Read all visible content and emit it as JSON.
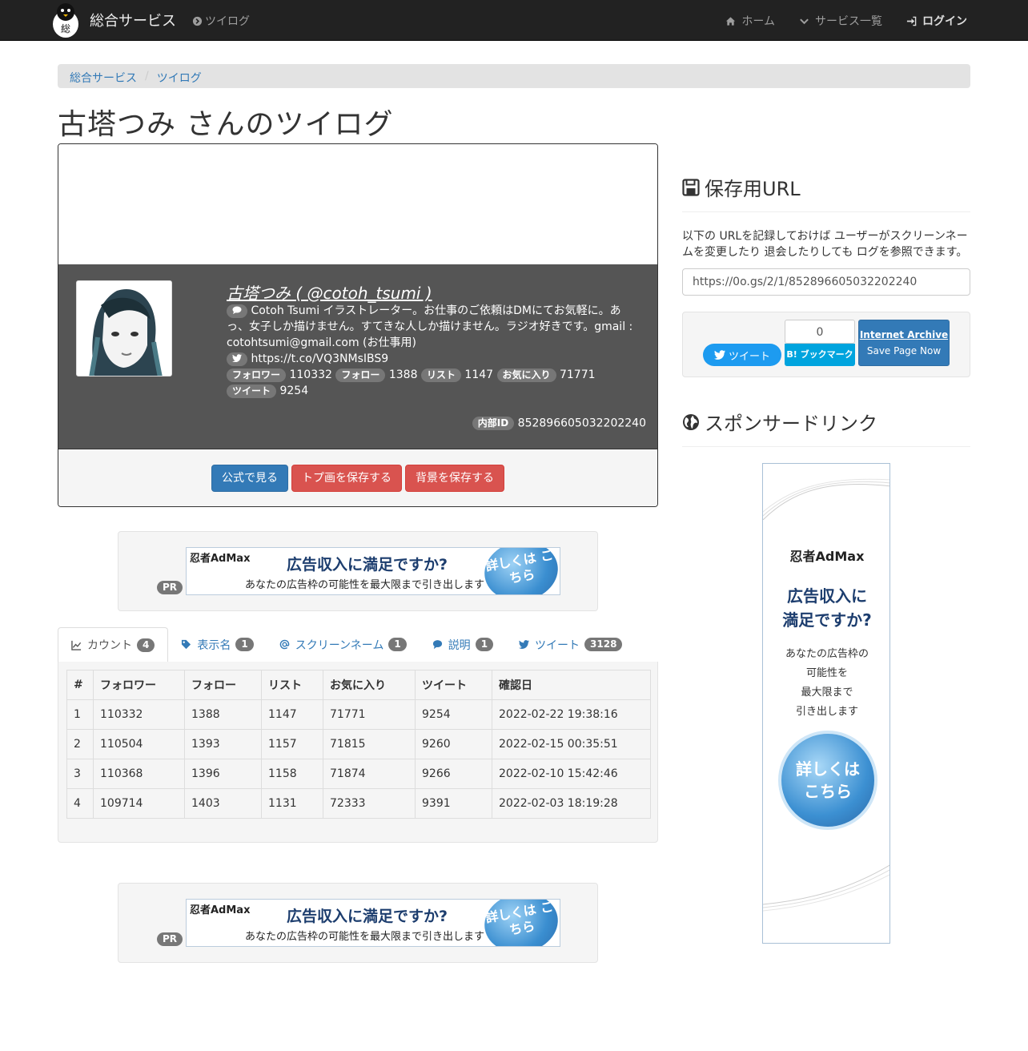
{
  "navbar": {
    "brand": "総合サービス",
    "brand_logo_char": "総",
    "twilog": "ツイログ",
    "home": "ホーム",
    "services": "サービス一覧",
    "login": "ログイン"
  },
  "breadcrumb": [
    "総合サービス",
    "ツイログ"
  ],
  "page_title": "古塔つみ さんのツイログ",
  "profile": {
    "name": "古塔つみ ( @cotoh_tsumi )",
    "description": "Cotoh Tsumi イラストレーター。お仕事のご依頼はDMにてお気軽に。あっ、女子しか描けません。すてきな人しか描けません。ラジオ好きです。gmail : cotohtsumi@gmail.com (お仕事用)",
    "url": "https://t.co/VQ3NMsIBS9",
    "stats": [
      {
        "label": "フォロワー",
        "value": "110332"
      },
      {
        "label": "フォロー",
        "value": "1388"
      },
      {
        "label": "リスト",
        "value": "1147"
      },
      {
        "label": "お気に入り",
        "value": "71771"
      },
      {
        "label": "ツイート",
        "value": "9254"
      }
    ],
    "internal_label": "内部ID",
    "internal_id": "852896605032202240",
    "buttons": {
      "official": "公式で見る",
      "save_icon": "トプ画を保存する",
      "save_bg": "背景を保存する"
    }
  },
  "ad": {
    "pr": "PR",
    "brand": "忍者AdMax",
    "line1": "広告収入に満足ですか?",
    "line2": "あなたの広告枠の可能性を最大限まで引き出します",
    "circle": "詳しくは こちら"
  },
  "tabs": [
    {
      "label": "カウント",
      "count": "4"
    },
    {
      "label": "表示名",
      "count": "1"
    },
    {
      "label": "スクリーンネーム",
      "count": "1"
    },
    {
      "label": "説明",
      "count": "1"
    },
    {
      "label": "ツイート",
      "count": "3128"
    }
  ],
  "table": {
    "headers": [
      "#",
      "フォロワー",
      "フォロー",
      "リスト",
      "お気に入り",
      "ツイート",
      "確認日"
    ],
    "rows": [
      [
        "1",
        "110332",
        "1388",
        "1147",
        "71771",
        "9254",
        "2022-02-22 19:38:16"
      ],
      [
        "2",
        "110504",
        "1393",
        "1157",
        "71815",
        "9260",
        "2022-02-15 00:35:51"
      ],
      [
        "3",
        "110368",
        "1396",
        "1158",
        "71874",
        "9266",
        "2022-02-10 15:42:46"
      ],
      [
        "4",
        "109714",
        "1403",
        "1131",
        "72333",
        "9391",
        "2022-02-03 18:19:28"
      ]
    ]
  },
  "sidebar": {
    "save_title": "保存用URL",
    "save_text": "以下の URLを記録しておけば ユーザーがスクリーンネームを変更したり 退会したりしても ログを参照できます。",
    "save_url": "https://0o.gs/2/1/852896605032202240",
    "tweet_btn": "ツイート",
    "hatena_count": "0",
    "hatena_btn": "B! ブックマーク",
    "ia_title": "Internet Archive",
    "ia_sub": "Save Page Now",
    "sponsor_title": "スポンサードリンク"
  },
  "side_ad": {
    "brand": "忍者AdMax",
    "line1a": "広告収入に",
    "line1b": "満足ですか?",
    "line2": [
      "あなたの広告枠の",
      "可能性を",
      "最大限まで",
      "引き出します"
    ],
    "circle_a": "詳しくは",
    "circle_b": "こちら"
  }
}
